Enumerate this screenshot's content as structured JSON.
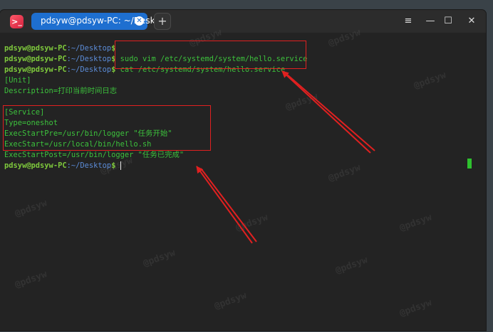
{
  "window": {
    "tab_title": "pdsyw@pdsyw-PC: ~/Desktop",
    "add_tab_label": "+",
    "controls": {
      "menu": "≡",
      "minimize": "—",
      "maximize": "☐",
      "close": "✕"
    }
  },
  "terminal": {
    "prompt_user": "pdsyw@pdsyw-PC",
    "prompt_path": ":~/Desktop",
    "prompt_symbol": "$",
    "commands": [
      "",
      " sudo vim /etc/systemd/system/hello.service",
      " cat /etc/systemd/system/hello.service"
    ],
    "output": [
      "[Unit]",
      "Description=打印当前时间日志",
      "",
      "[Service]",
      "Type=oneshot",
      "ExecStartPre=/usr/bin/logger \"任务开始\"",
      "ExecStart=/usr/local/bin/hello.sh",
      "ExecStartPost=/usr/bin/logger \"任务已完成\""
    ],
    "last_prompt_input": " "
  },
  "colors": {
    "tab_active": "#1e6fd0",
    "prompt_user": "#7ec93c",
    "prompt_path": "#5b8bd6",
    "output_text": "#3cc13c",
    "annotation": "#e02020"
  }
}
